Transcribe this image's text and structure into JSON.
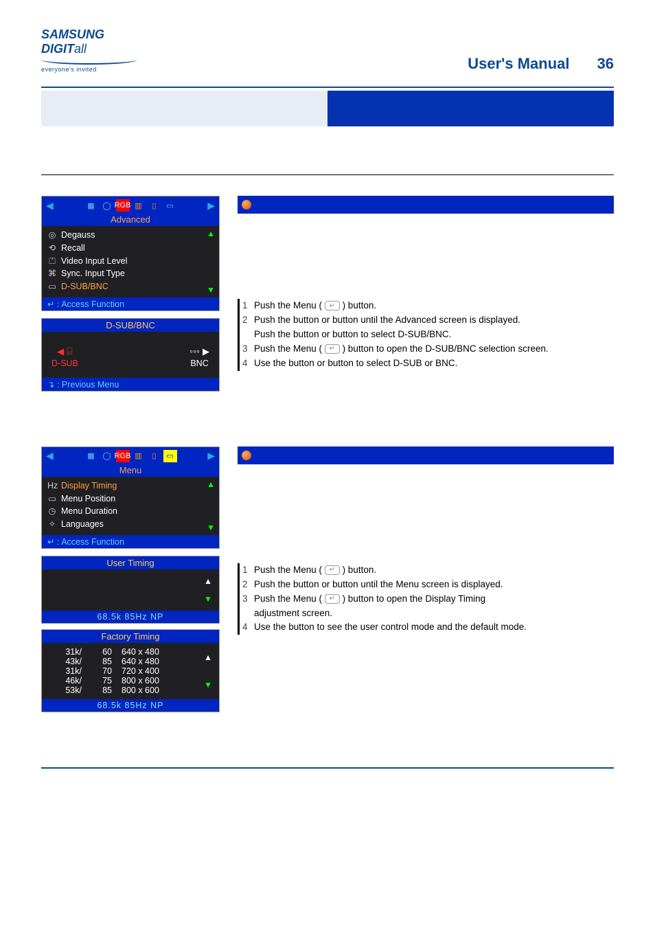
{
  "header": {
    "brand_main": "SAMSUNG DIGIT",
    "brand_suffix": "all",
    "brand_tag": "everyone's invited",
    "manual_title": "User's Manual",
    "page_number": "36"
  },
  "osd1": {
    "top_label": "Advanced",
    "items": [
      {
        "icon": "◎",
        "label": "Degauss",
        "active": false
      },
      {
        "icon": "⟲",
        "label": "Recall",
        "active": false
      },
      {
        "icon": "⏍",
        "label": "Video Input Level",
        "active": false
      },
      {
        "icon": "⌘",
        "label": "Sync. Input Type",
        "active": false
      },
      {
        "icon": "▭",
        "label": "D-SUB/BNC",
        "active": true
      }
    ],
    "footer": "↵ : Access Function",
    "sub": {
      "title": "D-SUB/BNC",
      "left_label": "D-SUB",
      "right_label": "BNC",
      "footer": "↴ : Previous Menu"
    }
  },
  "steps1": [
    {
      "n": "1",
      "pre": "Push the Menu ( ",
      "post": " ) button."
    },
    {
      "n": "2",
      "text": "Push the    button or    button until the Advanced screen is displayed."
    },
    {
      "n": "",
      "text": "Push the    button or    button to select D-SUB/BNC."
    },
    {
      "n": "3",
      "pre": "Push the Menu ( ",
      "post": " ) button to open the D-SUB/BNC selection screen."
    },
    {
      "n": "4",
      "text": "Use the    button or    button to select D-SUB or BNC."
    }
  ],
  "osd2": {
    "top_label": "Menu",
    "items": [
      {
        "icon": "Hz",
        "label": "Display Timing",
        "active": true
      },
      {
        "icon": "▭",
        "label": "Menu Position",
        "active": false
      },
      {
        "icon": "◷",
        "label": "Menu Duration",
        "active": false
      },
      {
        "icon": "✧",
        "label": "Languages",
        "active": false
      }
    ],
    "footer": "↵ : Access Function",
    "user_timing": {
      "title": "User Timing",
      "status": "68.5k     85Hz   NP"
    },
    "factory_timing": {
      "title": "Factory Timing",
      "rows": [
        {
          "k": "31k/",
          "r": "60",
          "res": "640 x 480"
        },
        {
          "k": "43k/",
          "r": "85",
          "res": "640 x 480"
        },
        {
          "k": "31k/",
          "r": "70",
          "res": "720 x 400"
        },
        {
          "k": "46k/",
          "r": "75",
          "res": "800 x 600"
        },
        {
          "k": "53k/",
          "r": "85",
          "res": "800 x 600"
        }
      ],
      "status": "68.5k     85Hz   NP"
    }
  },
  "steps2": [
    {
      "n": "1",
      "pre": "Push the Menu ( ",
      "post": " ) button."
    },
    {
      "n": "2",
      "text": "Push the    button or    button until the Menu screen is displayed."
    },
    {
      "n": "3",
      "pre": "Push the Menu ( ",
      "post": " ) button to open the Display Timing"
    },
    {
      "n": "",
      "text": "adjustment screen."
    },
    {
      "n": "4",
      "text": "Use the    button to see the user control mode and the default mode."
    }
  ]
}
